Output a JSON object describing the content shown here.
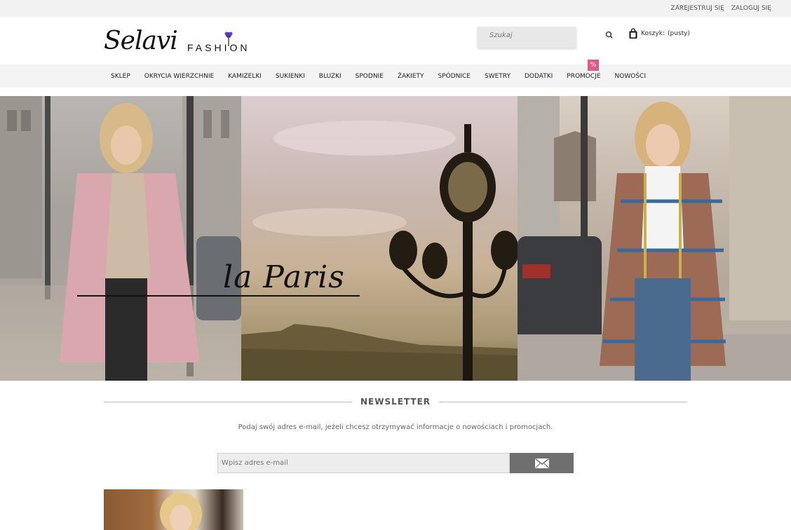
{
  "topbar": {
    "register": "Zarejestruj się",
    "login": "Zaloguj się"
  },
  "header": {
    "logo_script": "Selavi",
    "logo_fashion": "FASHION",
    "search_placeholder": "Szukaj",
    "cart_label": "Koszyk:",
    "cart_status": "(pusty)"
  },
  "nav": {
    "items": [
      "Sklep",
      "Okrycia wierzchnie",
      "Kamizelki",
      "Sukienki",
      "Bluzki",
      "Spodnie",
      "Żakiety",
      "Spódnice",
      "Swetry",
      "Dodatki",
      "Promocje",
      "Nowości"
    ],
    "promo_badge": "%"
  },
  "hero": {
    "text": "la Paris"
  },
  "newsletter": {
    "title": "NEWSLETTER",
    "description": "Podaj swój adres e-mail, jeżeli chcesz otrzymywać informacje o nowościach i promocjach.",
    "email_placeholder": "Wpisz adres e-mail"
  },
  "icons": {
    "search": "search-icon",
    "cart": "shopping-bag-icon",
    "submit": "envelope-icon",
    "logo_flower": "flower-icon"
  },
  "colors": {
    "promo_badge": "#e05a86",
    "newsletter_button": "#6f6f6f"
  }
}
